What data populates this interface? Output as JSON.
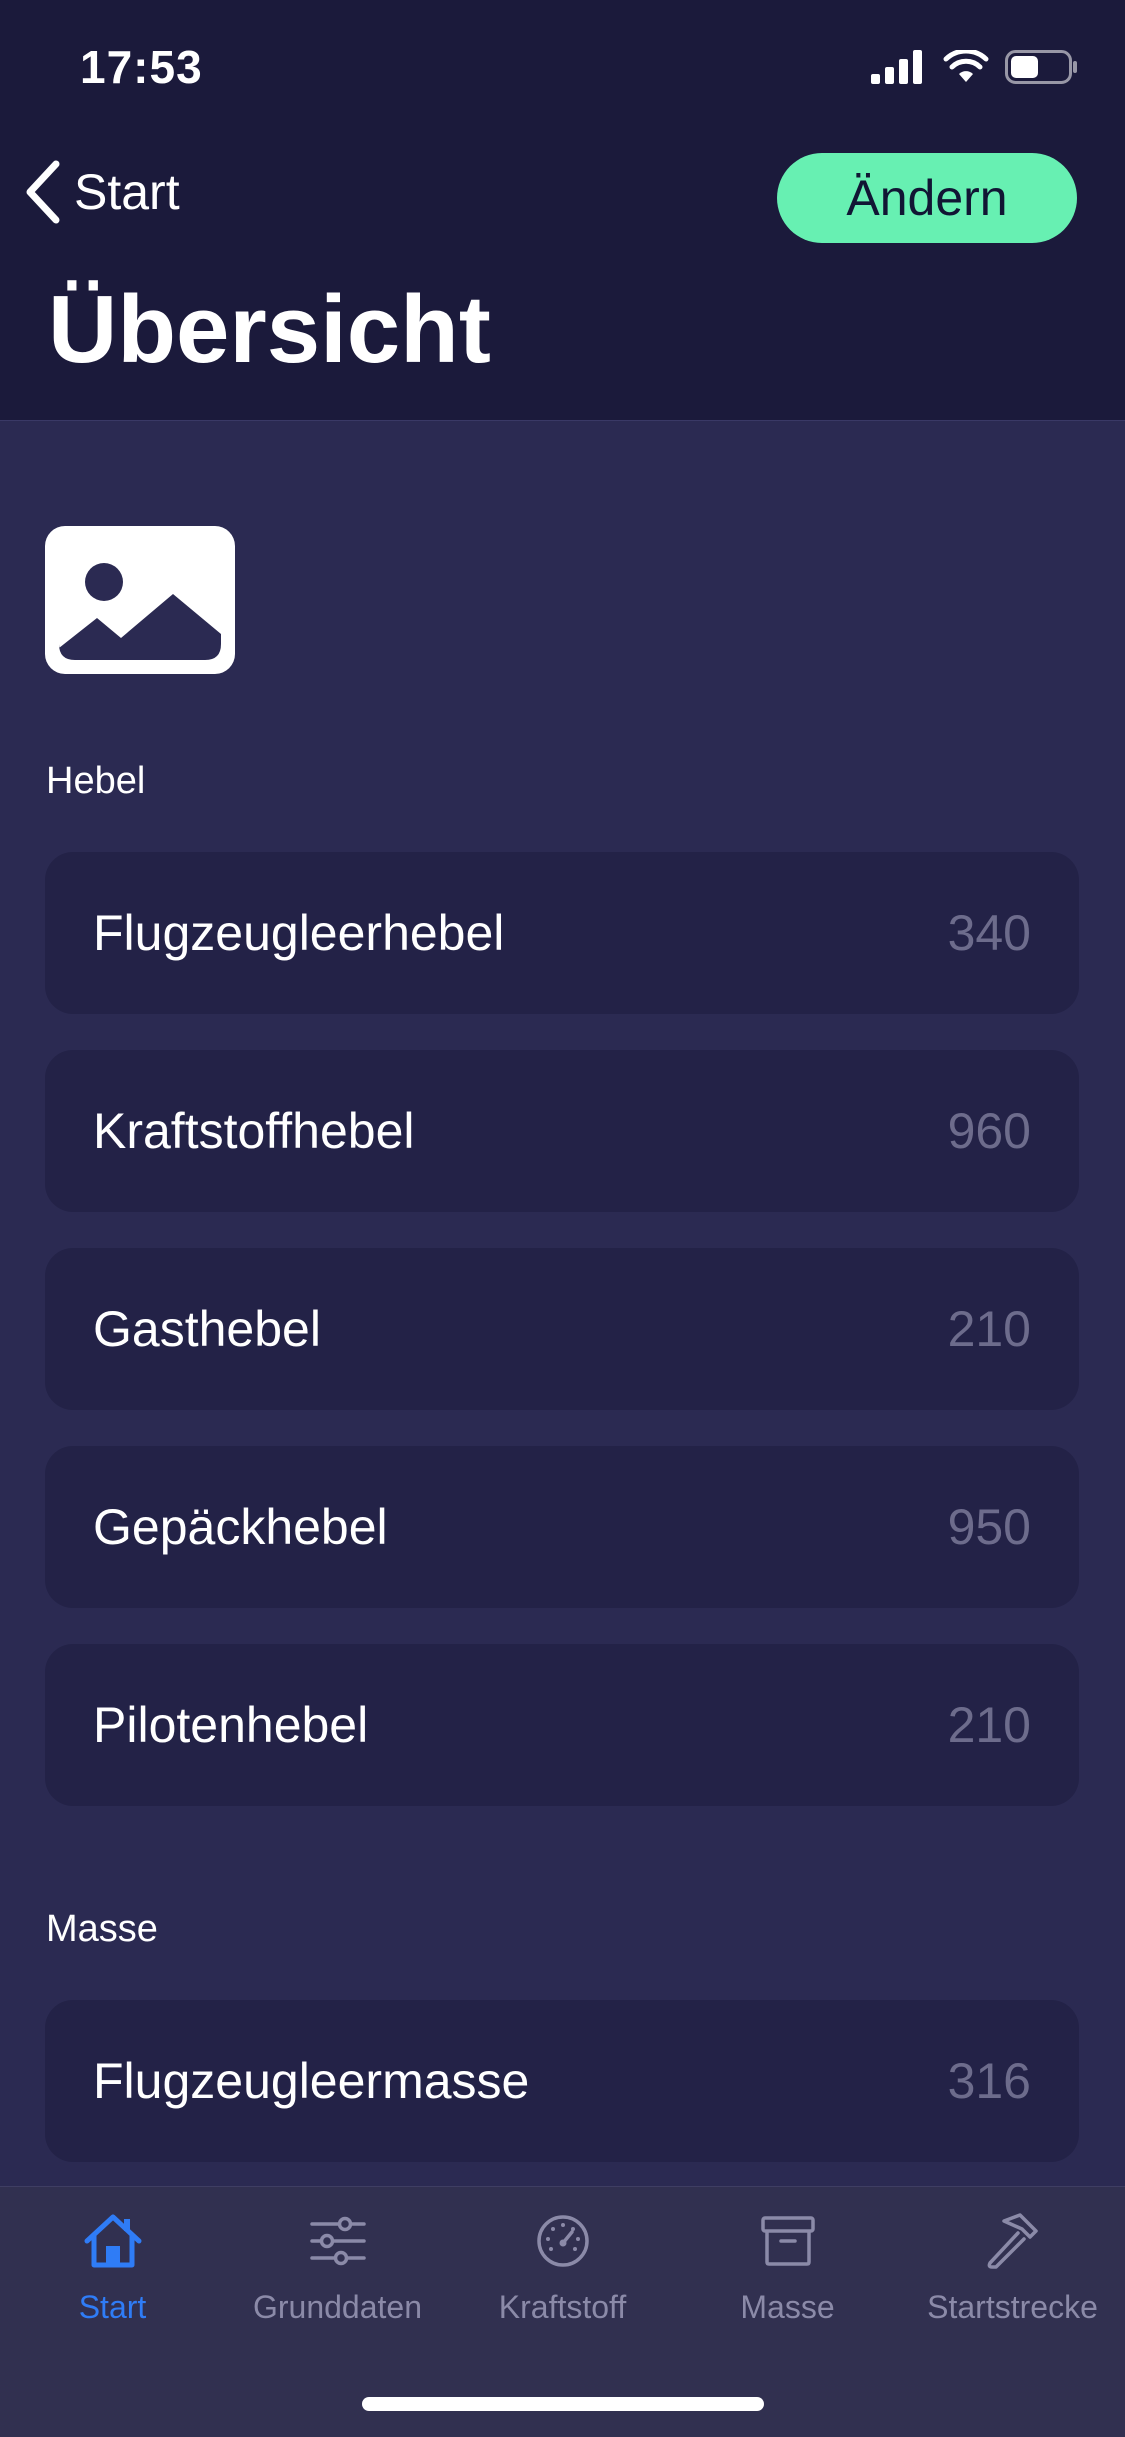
{
  "status_bar": {
    "time": "17:53"
  },
  "nav": {
    "back_label": "Start",
    "edit_label": "Ändern",
    "title": "Übersicht"
  },
  "image_placeholder_icon": "image-icon",
  "sections": {
    "hebel": {
      "label": "Hebel",
      "rows": [
        {
          "label": "Flugzeugleerhebel",
          "value": "340"
        },
        {
          "label": "Kraftstoffhebel",
          "value": "960"
        },
        {
          "label": "Gasthebel",
          "value": "210"
        },
        {
          "label": "Gepäckhebel",
          "value": "950"
        },
        {
          "label": "Pilotenhebel",
          "value": "210"
        }
      ]
    },
    "masse": {
      "label": "Masse",
      "rows": [
        {
          "label": "Flugzeugleermasse",
          "value": "316"
        }
      ]
    }
  },
  "tabbar": {
    "tabs": [
      {
        "label": "Start",
        "icon": "house-icon",
        "active": true
      },
      {
        "label": "Grunddaten",
        "icon": "sliders-icon",
        "active": false
      },
      {
        "label": "Kraftstoff",
        "icon": "gauge-icon",
        "active": false
      },
      {
        "label": "Masse",
        "icon": "archivebox-icon",
        "active": false
      },
      {
        "label": "Startstrecke",
        "icon": "hammer-icon",
        "active": false
      }
    ]
  },
  "colors": {
    "header_bg": "#1b1a3b",
    "content_bg": "#2b2a52",
    "row_bg": "#232247",
    "accent_button": "#67f0b2",
    "active_tab": "#2f7cf6",
    "inactive_tab": "#8b8aa8"
  }
}
